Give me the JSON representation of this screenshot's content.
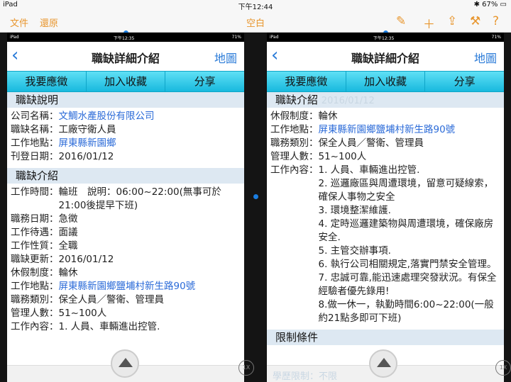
{
  "status": {
    "device": "iPad",
    "time": "下午12:44",
    "battery": "67%"
  },
  "app": {
    "file": "文件",
    "undo": "還原",
    "title": "空白"
  },
  "mini_status": {
    "device": "iPad",
    "time": "下午12:35",
    "battery": "71%"
  },
  "left": {
    "nav_title": "職缺詳細介紹",
    "map": "地圖",
    "tabs": [
      "我要應徵",
      "加入收藏",
      "分享"
    ],
    "sec1": "職缺說明",
    "company_label": "公司名稱：",
    "company": "文鯛水產股份有限公司",
    "job_label": "職缺名稱：",
    "job": "工廠守衛人員",
    "loc_label": "工作地點：",
    "loc": "屏東縣新園鄉",
    "date_label": "刊登日期：",
    "date": "2016/01/12",
    "sec2": "職缺介紹",
    "time_label": "工作時間：",
    "time": "輪班　說明：06:00~22:00(無事可於21:00後提早下班)",
    "start_label": "職務日期：",
    "start": "急徵",
    "pay_label": "工作待遇：",
    "pay": "面議",
    "nature_label": "工作性質：",
    "nature": "全職",
    "update_label": "職缺更新：",
    "update": "2016/01/12",
    "holiday_label": "休假制度：",
    "holiday": "輪休",
    "loc2_label": "工作地點：",
    "loc2": "屏東縣新園鄉鹽埔村新生路90號",
    "cat_label": "職務類別：",
    "cat": "保全人員／警衛、管理員",
    "need_label": "管理人數：",
    "need": "51~100人",
    "content_label": "工作內容：",
    "content": "1. 人員、車輛進出控管."
  },
  "right": {
    "nav_title": "職缺詳細介紹",
    "map": "地圖",
    "tabs": [
      "我要應徵",
      "加入收藏",
      "分享"
    ],
    "sec1": "職缺介紹",
    "sec1_fade": "2016/01/12",
    "holiday_label": "休假制度：",
    "holiday": "輪休",
    "loc_label": "工作地點：",
    "loc": "屏東縣新園鄉鹽埔村新生路90號",
    "cat_label": "職務類別：",
    "cat": "保全人員／警衛、管理員",
    "need_label": "管理人數：",
    "need": "51~100人",
    "content_label": "工作內容：",
    "content_lines": [
      "1. 人員、車輛進出控管.",
      "2. 巡邏廠區與周遭環境，留意可疑線索，確保人事物之安全",
      "3. 環境整潔維護.",
      "4. 定時巡邏建築物與周遭環境，確保廠房安全.",
      "5. 主管交辦事項.",
      "6. 執行公司相關規定,落實門禁安全管理。",
      "7. 忠誠可靠,能迅速處理突發狀況。有保全經驗者優先錄用!",
      "8.做一休一，執勤時間6:00~22:00(一般約21點多即可下班)"
    ],
    "sec2": "限制條件",
    "fade_bottom": "學歷限制：不限"
  },
  "zoom": "1X",
  "colors": {
    "accent": "#e8962e",
    "link": "#2a6ad8",
    "tab": "#18b9de"
  }
}
